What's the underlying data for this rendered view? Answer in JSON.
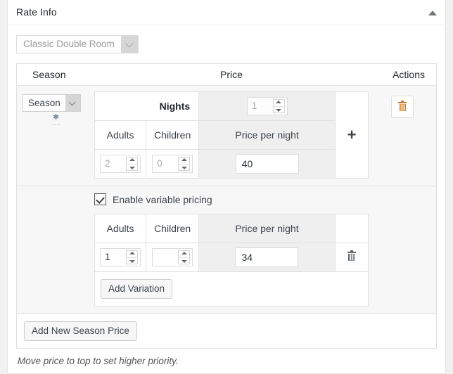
{
  "panel": {
    "title": "Rate Info",
    "toggle_icon": "chevron-up-icon"
  },
  "room_select": {
    "value": "Classic Double Room",
    "arrow_icon": "chevron-down-icon"
  },
  "table": {
    "headers": {
      "season": "Season",
      "price": "Price",
      "actions": "Actions"
    }
  },
  "season_row": {
    "season_select_value": "Season",
    "season_select_arrow_icon": "chevron-down-icon",
    "sort_handle_icon": "move-handle-icon",
    "sort_handle_glyph": "✱",
    "sort_dots_glyph": "...",
    "nights_label": "Nights",
    "nights_value": "1",
    "adults_label": "Adults",
    "children_label": "Children",
    "price_per_night_label": "Price per night",
    "adults_value": "2",
    "children_value": "0",
    "price_value": "40",
    "add_icon": "plus-icon",
    "add_glyph": "+",
    "delete_icon": "trash-icon"
  },
  "variable_pricing": {
    "checkbox_label": "Enable variable pricing",
    "checkbox_checked": true,
    "headers": {
      "adults": "Adults",
      "children": "Children",
      "price_per_night": "Price per night"
    },
    "variations": [
      {
        "adults": "1",
        "children": "",
        "price": "34",
        "delete_icon": "trash-icon"
      }
    ],
    "add_variation_label": "Add Variation"
  },
  "footer": {
    "add_season_label": "Add New Season Price",
    "note": "Move price to top to set higher priority."
  }
}
